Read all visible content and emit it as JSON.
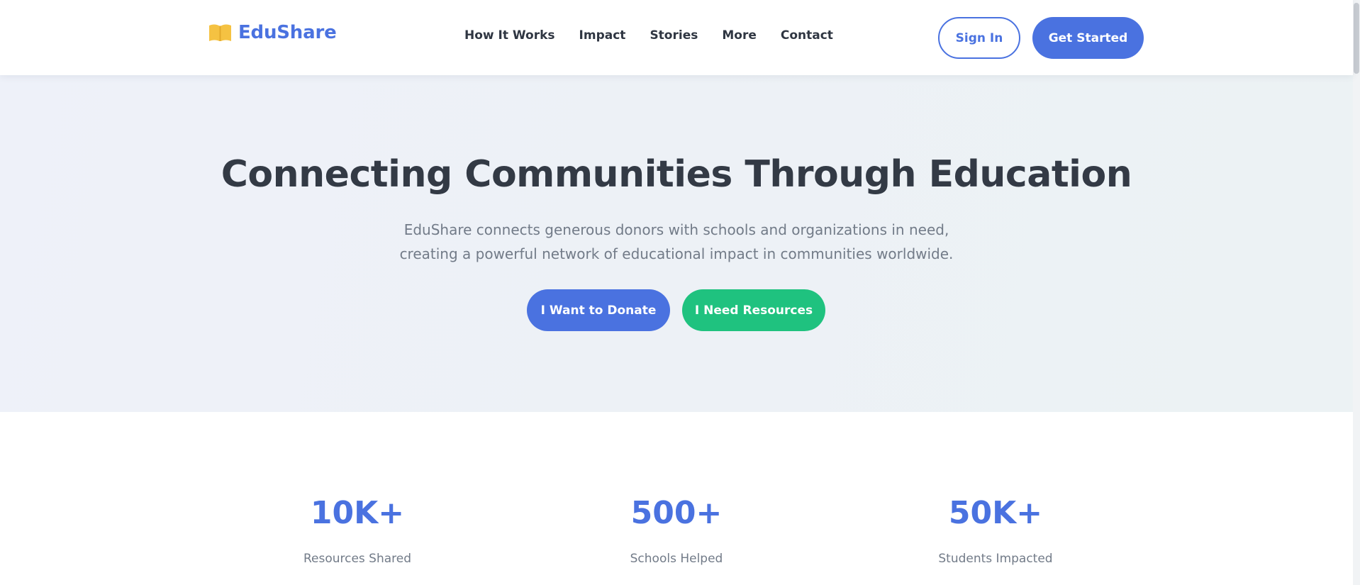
{
  "header": {
    "logo_text": "EduShare",
    "logo_icon": "open-book-icon",
    "nav": [
      {
        "label": "How It Works"
      },
      {
        "label": "Impact"
      },
      {
        "label": "Stories"
      },
      {
        "label": "More"
      },
      {
        "label": "Contact"
      }
    ],
    "sign_in_label": "Sign In",
    "get_started_label": "Get Started"
  },
  "hero": {
    "title": "Connecting Communities Through Education",
    "subtitle_line1": "EduShare connects generous donors with schools and organizations in need,",
    "subtitle_line2": "creating a powerful network of educational impact in communities worldwide.",
    "donate_label": "I Want to Donate",
    "resources_label": "I Need Resources"
  },
  "stats": [
    {
      "value": "10K+",
      "label": "Resources Shared"
    },
    {
      "value": "500+",
      "label": "Schools Helped"
    },
    {
      "value": "50K+",
      "label": "Students Impacted"
    }
  ],
  "colors": {
    "primary": "#4a72e0",
    "accent_green": "#1fc27f",
    "logo_yellow": "#f5c242",
    "text_dark": "#333a45",
    "text_muted": "#727b88"
  }
}
